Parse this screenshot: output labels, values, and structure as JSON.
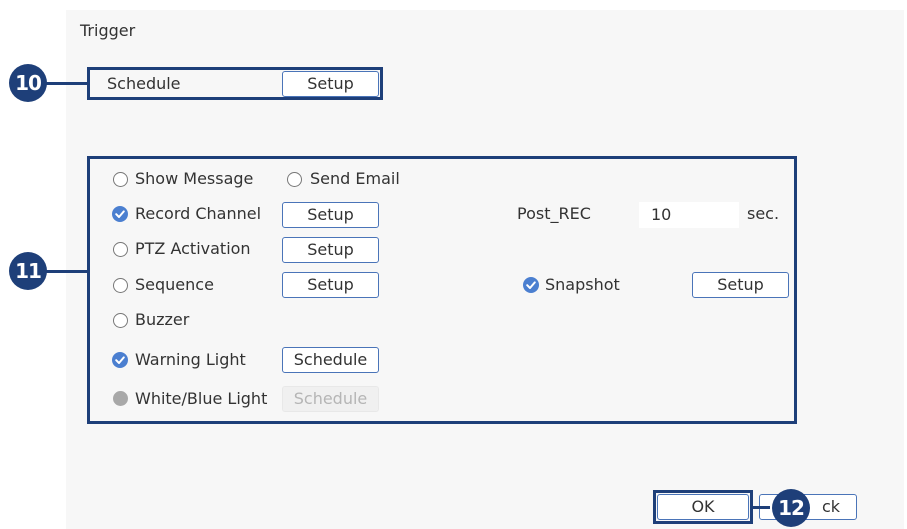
{
  "title": "Trigger",
  "schedule": {
    "label": "Schedule",
    "button": "Setup"
  },
  "options": {
    "show_message": {
      "label": "Show Message",
      "checked": false
    },
    "send_email": {
      "label": "Send Email",
      "checked": false
    },
    "record_channel": {
      "label": "Record Channel",
      "checked": true,
      "button": "Setup"
    },
    "post_rec": {
      "label": "Post_REC",
      "value": "10",
      "unit": "sec."
    },
    "ptz_activation": {
      "label": "PTZ Activation",
      "checked": false,
      "button": "Setup"
    },
    "sequence": {
      "label": "Sequence",
      "checked": false,
      "button": "Setup"
    },
    "snapshot": {
      "label": "Snapshot",
      "checked": true,
      "button": "Setup"
    },
    "buzzer": {
      "label": "Buzzer",
      "checked": false
    },
    "warning_light": {
      "label": "Warning Light",
      "checked": true,
      "button": "Schedule"
    },
    "white_blue_light": {
      "label": "White/Blue Light",
      "disabled": true,
      "button": "Schedule"
    }
  },
  "footer": {
    "ok": "OK",
    "back": "Back",
    "back_visible": "ck"
  },
  "callouts": {
    "c10": "10",
    "c11": "11",
    "c12": "12"
  },
  "colors": {
    "highlight": "#1e3f79",
    "accent": "#4b7fd0",
    "button_border": "#4a74b8"
  }
}
